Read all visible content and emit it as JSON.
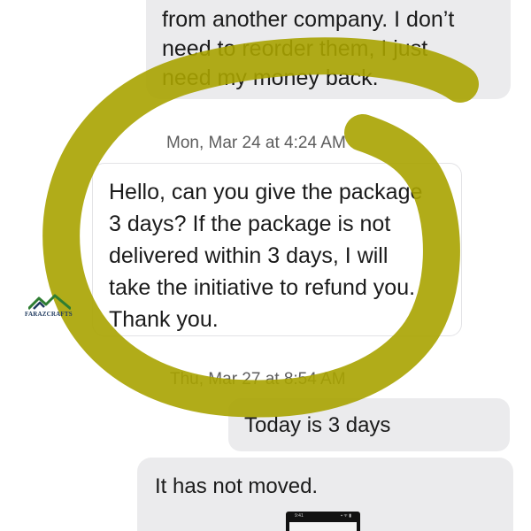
{
  "messages": {
    "top_bubble": {
      "lines": [
        "from another company. I don’t",
        "need to reorder them, I just",
        "need my money back."
      ]
    },
    "timestamp_1": "Mon, Mar 24 at 4:24 AM",
    "seller_reply": {
      "lines": [
        "Hello, can you give the package",
        "3 days? If the package is not",
        "delivered within 3 days, I will",
        "take the initiative to refund you.",
        "Thank you."
      ]
    },
    "timestamp_2": "Thu, Mar 27 at 8:54 AM",
    "sent_bubble": "Today is 3 days",
    "bottom_bubble": "It has not moved."
  },
  "attachment_thumbnail": {
    "status_time": "9:41",
    "status_icons": "▪ ᯤ ▮"
  },
  "watermark": {
    "text": "FARAZCRAFTS"
  },
  "highlight": {
    "color": "#a8a300"
  }
}
